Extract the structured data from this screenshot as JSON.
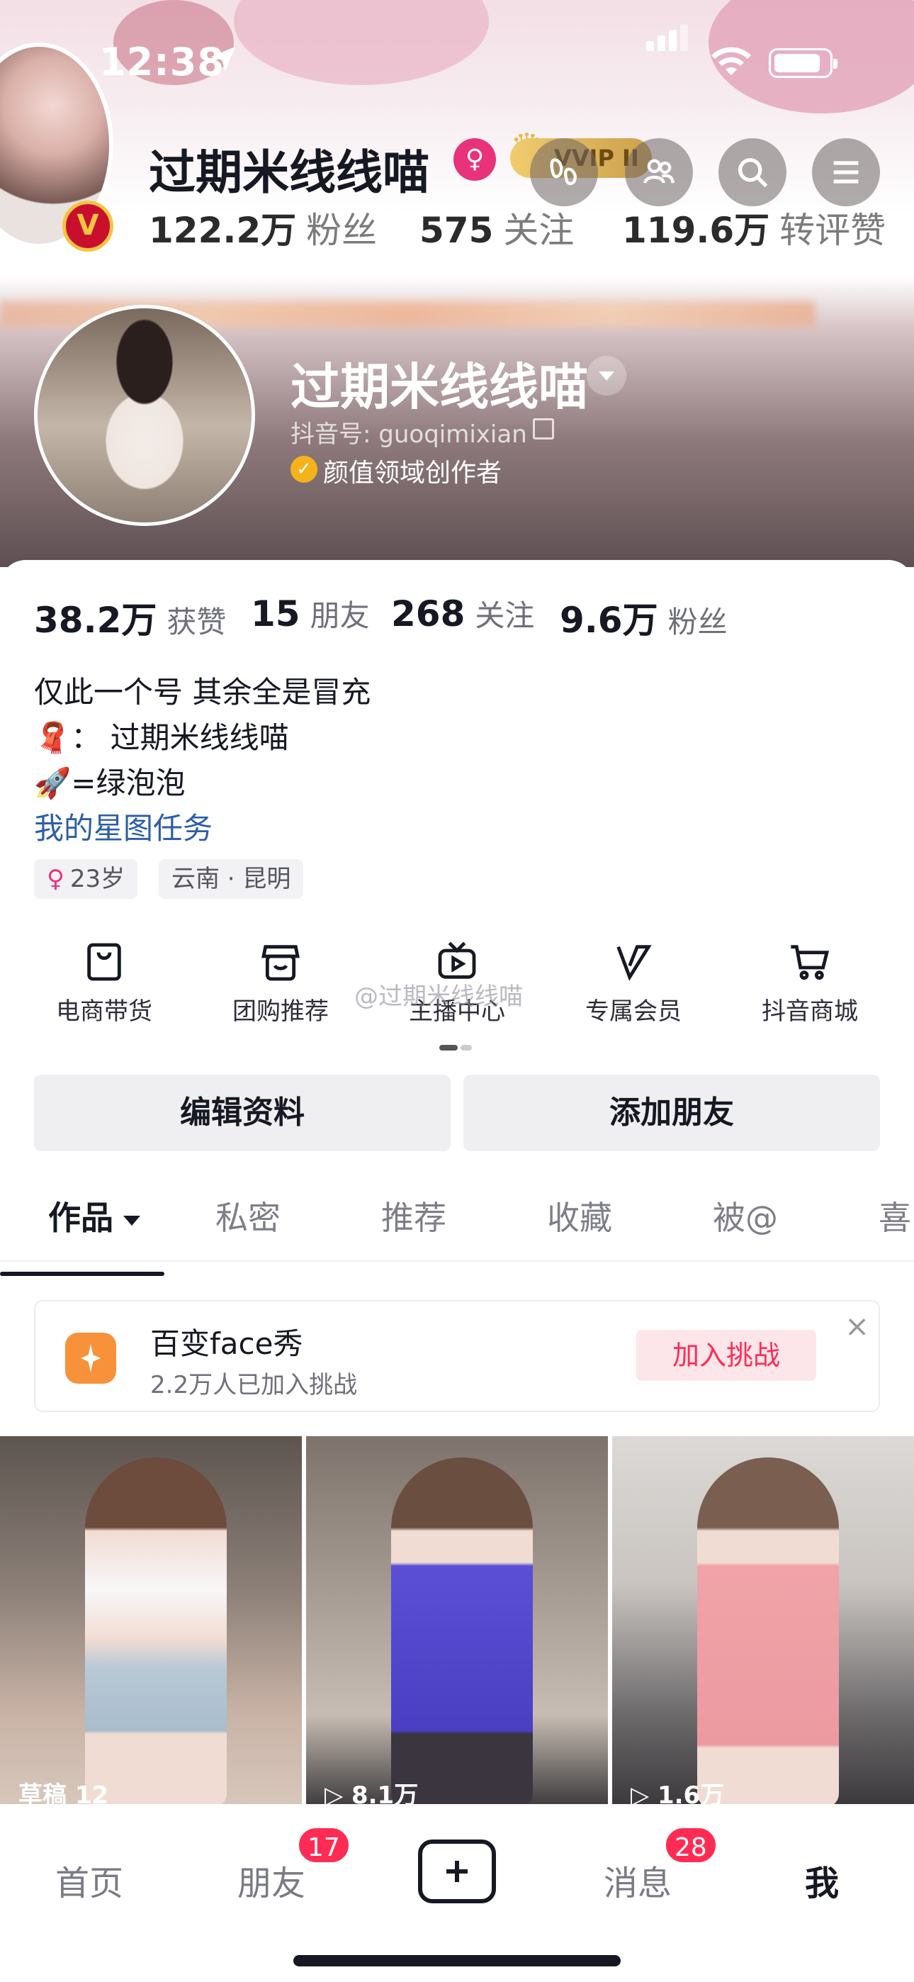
{
  "status_bar": {
    "time": "12:38"
  },
  "header": {
    "name": "过期米线线喵",
    "vip_label": "VVIP II",
    "verified_mark": "V",
    "stats": [
      {
        "value": "122.2万",
        "label": "粉丝"
      },
      {
        "value": "575",
        "label": "关注"
      },
      {
        "value": "119.6万",
        "label": "转评赞"
      }
    ]
  },
  "profile": {
    "name": "过期米线线喵",
    "douyin_id": "抖音号: guoqimixian",
    "certification": "颜值领域创作者"
  },
  "stats": [
    {
      "value": "38.2万",
      "label": "获赞"
    },
    {
      "value": "15",
      "label": "朋友"
    },
    {
      "value": "268",
      "label": "关注"
    },
    {
      "value": "9.6万",
      "label": "粉丝"
    }
  ],
  "bio": {
    "line1": "仅此一个号 其余全是冒充",
    "line2_emoji": "🧣",
    "line2": "： 过期米线线喵",
    "line3_emoji": "🚀",
    "line3": "=绿泡泡",
    "link": "我的星图任务"
  },
  "tags": {
    "age": "23岁",
    "location": "云南 · 昆明"
  },
  "services": [
    {
      "label": "电商带货",
      "icon": "shopping-bag-icon"
    },
    {
      "label": "团购推荐",
      "icon": "store-icon"
    },
    {
      "label": "主播中心",
      "icon": "tv-play-icon"
    },
    {
      "label": "专属会员",
      "icon": "v-badge-icon"
    },
    {
      "label": "抖音商城",
      "icon": "cart-icon"
    }
  ],
  "watermark": "@过期米线线喵",
  "buttons": {
    "edit": "编辑资料",
    "add_friend": "添加朋友"
  },
  "tabs": [
    "作品",
    "私密",
    "推荐",
    "收藏",
    "被@",
    "喜"
  ],
  "challenge": {
    "title": "百变face秀",
    "subtitle": "2.2万人已加入挑战",
    "join": "加入挑战",
    "close": "×"
  },
  "thumbnails": [
    {
      "label": "草稿 12"
    },
    {
      "label": "▷ 8.1万"
    },
    {
      "label": "▷ 1.6万"
    }
  ],
  "nav": {
    "home": "首页",
    "friends": "朋友",
    "friends_badge": "17",
    "messages": "消息",
    "messages_badge": "28",
    "me": "我"
  },
  "colors": {
    "accent_red": "#fe2c55",
    "link_blue": "#2b5ea8",
    "text": "#161823"
  }
}
